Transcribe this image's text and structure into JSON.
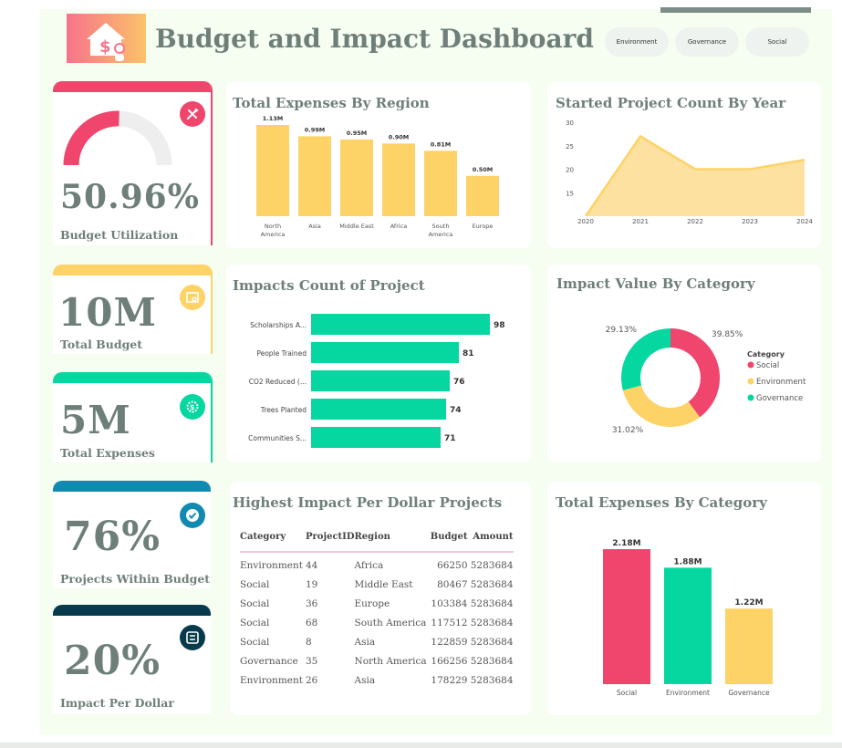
{
  "header": {
    "title": "Budget and Impact Dashboard",
    "filters": [
      "Environment",
      "Governance",
      "Social"
    ]
  },
  "colors": {
    "pink": "#f0456c",
    "yellow": "#fdd367",
    "green": "#06d6a0",
    "blue": "#118ab2",
    "navy": "#073b4c",
    "text": "#6e7f79"
  },
  "kpis": {
    "budget_utilization": {
      "value": "50.96%",
      "label": "Budget Utilization",
      "fraction": 0.5096,
      "icon": "tools-icon"
    },
    "total_budget": {
      "value": "10M",
      "label": "Total Budget",
      "icon": "calendar-search-icon"
    },
    "total_expenses": {
      "value": "5M",
      "label": "Total Expenses",
      "icon": "gear-badge-icon"
    },
    "projects_within_budget": {
      "value": "76%",
      "label": "Projects Within Budget",
      "icon": "check-icon"
    },
    "impact_per_dollar": {
      "value": "20%",
      "label": "Impact Per Dollar",
      "icon": "transfer-icon"
    }
  },
  "chart_data": [
    {
      "id": "expenses_by_region",
      "type": "bar",
      "title": "Total Expenses By Region",
      "categories": [
        [
          "North",
          "America"
        ],
        [
          "Asia"
        ],
        [
          "Middle East"
        ],
        [
          "Africa"
        ],
        [
          "South",
          "America"
        ],
        [
          "Europe"
        ]
      ],
      "values": [
        1.13,
        0.99,
        0.95,
        0.9,
        0.81,
        0.5
      ],
      "labels": [
        "1.13M",
        "0.99M",
        "0.95M",
        "0.90M",
        "0.81M",
        "0.50M"
      ],
      "ylim": [
        0,
        1.13
      ],
      "color": "#fdd367"
    },
    {
      "id": "projects_by_year",
      "type": "area",
      "title": "Started Project Count By Year",
      "x": [
        "2020",
        "2021",
        "2022",
        "2023",
        "2024"
      ],
      "values": [
        10,
        27,
        20,
        20,
        22
      ],
      "yticks": [
        15,
        20,
        25,
        30
      ],
      "ylim": [
        10,
        30
      ],
      "color": "#fdd367"
    },
    {
      "id": "impacts_count",
      "type": "bar",
      "orientation": "horizontal",
      "title": "Impacts Count of Project",
      "categories": [
        "Scholarships A...",
        "People Trained",
        "CO2 Reduced (...",
        "Trees Planted",
        "Communities S..."
      ],
      "values": [
        98,
        81,
        76,
        74,
        71
      ],
      "labels": [
        "98",
        "81",
        "76",
        "74",
        "71"
      ],
      "color": "#06d6a0"
    },
    {
      "id": "impact_value_by_category",
      "type": "pie",
      "title": "Impact Value By Category",
      "legend_title": "Category",
      "legend_position": "right",
      "slices": [
        {
          "name": "Social",
          "value": 39.85,
          "label": "39.85%",
          "color": "#f0456c"
        },
        {
          "name": "Environment",
          "value": 31.02,
          "label": "31.02%",
          "color": "#fdd367"
        },
        {
          "name": "Governance",
          "value": 29.13,
          "label": "29.13%",
          "color": "#06d6a0"
        }
      ]
    },
    {
      "id": "highest_impact_table",
      "type": "table",
      "title": "Highest Impact Per Dollar Projects",
      "columns": [
        "Category",
        "ProjectID",
        "Region",
        "Budget",
        "Amount"
      ],
      "rows": [
        [
          "Environment",
          "44",
          "Africa",
          "66250",
          "5283684"
        ],
        [
          "Social",
          "19",
          "Middle East",
          "80467",
          "5283684"
        ],
        [
          "Social",
          "36",
          "Europe",
          "103384",
          "5283684"
        ],
        [
          "Social",
          "68",
          "South America",
          "117512",
          "5283684"
        ],
        [
          "Social",
          "8",
          "Asia",
          "122859",
          "5283684"
        ],
        [
          "Governance",
          "35",
          "North America",
          "166256",
          "5283684"
        ],
        [
          "Environment",
          "26",
          "Asia",
          "178229",
          "5283684"
        ]
      ]
    },
    {
      "id": "expenses_by_category",
      "type": "bar",
      "title": "Total Expenses By Category",
      "categories": [
        "Social",
        "Environment",
        "Governance"
      ],
      "values": [
        2.18,
        1.88,
        1.22
      ],
      "labels": [
        "2.18M",
        "1.88M",
        "1.22M"
      ],
      "colors": [
        "#f0456c",
        "#06d6a0",
        "#fdd367"
      ],
      "ylim": [
        0,
        2.18
      ]
    }
  ]
}
